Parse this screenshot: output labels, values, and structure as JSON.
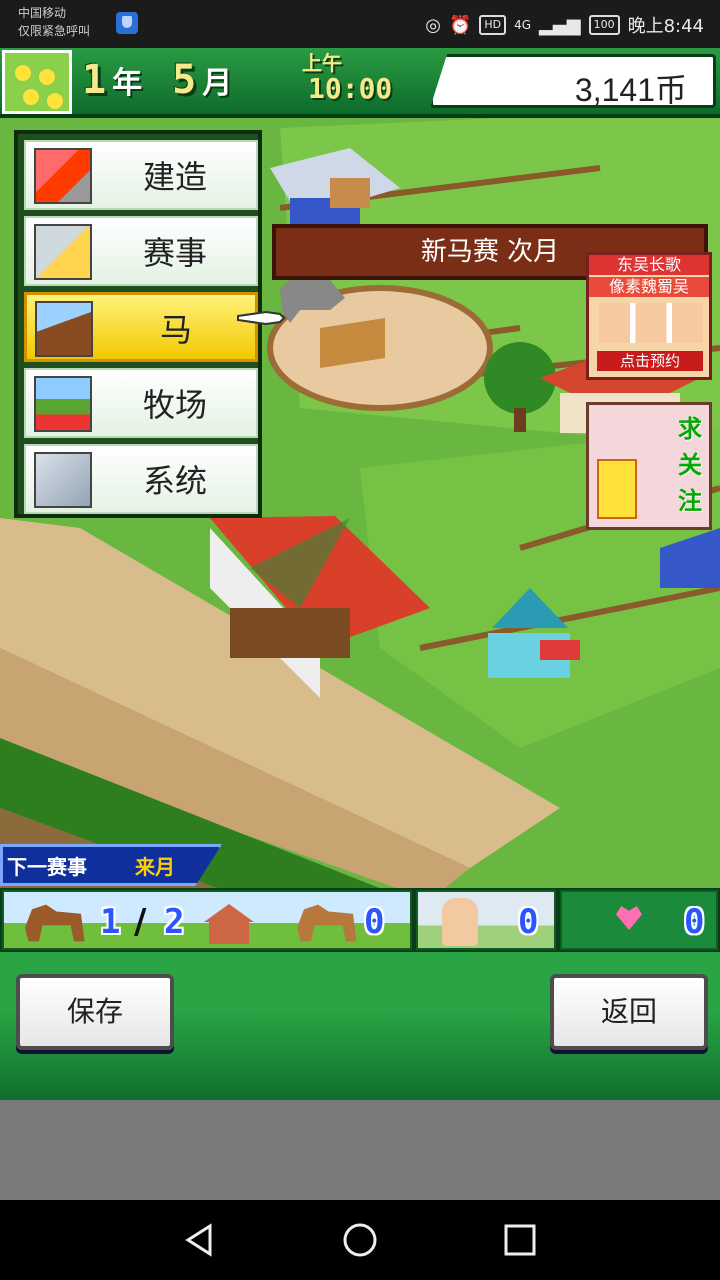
{
  "status_bar": {
    "carrier_line1": "中国移动",
    "carrier_line2": "仅限紧急呼叫",
    "hd": "HD",
    "network": "4G",
    "battery": "100",
    "time": "晚上8:44"
  },
  "hud": {
    "year_num": "1",
    "year_unit": "年",
    "month_num": "5",
    "month_unit": "月",
    "ampm": "上午",
    "clock": "10:00",
    "money": "3,141币"
  },
  "menu": {
    "items": [
      {
        "label": "建造",
        "icon": "construction-icon"
      },
      {
        "label": "赛事",
        "icon": "race-icon"
      },
      {
        "label": "马",
        "icon": "horse-icon",
        "selected": true
      },
      {
        "label": "牧场",
        "icon": "ranch-icon"
      },
      {
        "label": "系统",
        "icon": "system-icon"
      }
    ]
  },
  "banner": {
    "text": "新马赛 次月"
  },
  "ads": {
    "ad1": {
      "line1": "东吴长歌",
      "line2": "像素魏蜀吴",
      "cta": "点击预约"
    },
    "ad2": {
      "chars": [
        "求",
        "关",
        "注"
      ]
    }
  },
  "next_race": {
    "label": "下一赛事",
    "value": "来月"
  },
  "stats": {
    "horses": "1",
    "stable_capacity": "2",
    "foals": "0",
    "jockeys": "0",
    "pairs": "0"
  },
  "buttons": {
    "save": "保存",
    "back": "返回"
  },
  "colors": {
    "hud_green": "#1d8a3a",
    "menu_selected": "#f2c800",
    "banner_brown": "#7b2e16"
  }
}
